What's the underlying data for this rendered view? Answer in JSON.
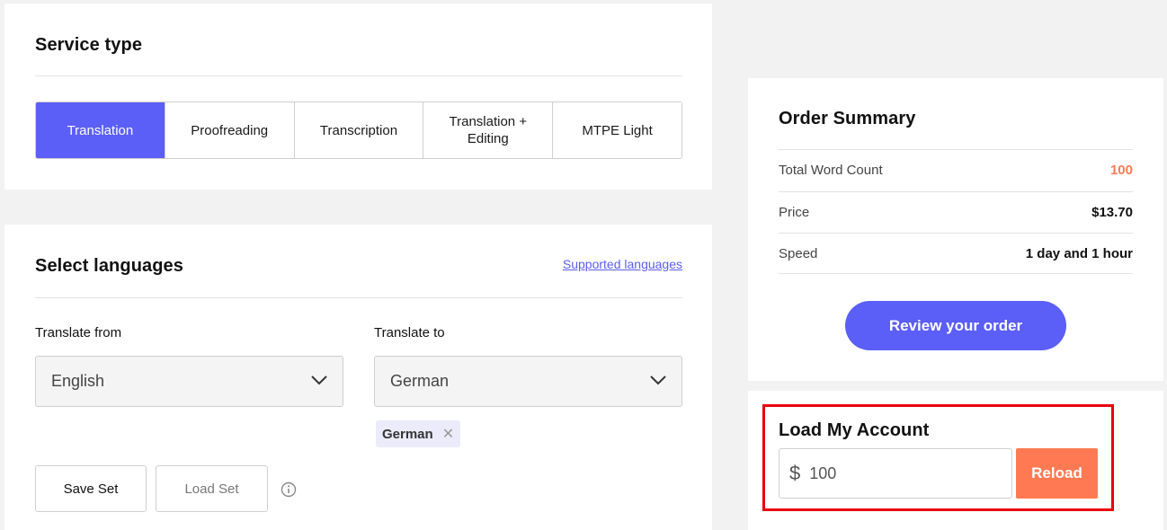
{
  "service": {
    "title": "Service type",
    "tabs": [
      {
        "label": "Translation",
        "active": true
      },
      {
        "label": "Proofreading",
        "active": false
      },
      {
        "label": "Transcription",
        "active": false
      },
      {
        "label": "Translation + Editing",
        "active": false
      },
      {
        "label": "MTPE Light",
        "active": false
      }
    ]
  },
  "languages": {
    "title": "Select languages",
    "supported_link": "Supported languages",
    "from_label": "Translate from",
    "from_value": "English",
    "to_label": "Translate to",
    "to_value": "German",
    "chip": "German",
    "save_set": "Save Set",
    "load_set": "Load Set"
  },
  "summary": {
    "title": "Order Summary",
    "word_count_label": "Total Word Count",
    "word_count_value": "100",
    "price_label": "Price",
    "price_value": "$13.70",
    "speed_label": "Speed",
    "speed_value": "1 day and 1 hour",
    "review_button": "Review your order"
  },
  "load_account": {
    "title": "Load My Account",
    "currency": "$",
    "amount": "100",
    "reload_button": "Reload"
  },
  "colors": {
    "accent": "#5b5ef7",
    "orange": "#ff7a52",
    "highlight": "#e8000b"
  },
  "icons": [
    "chevron-down-icon",
    "close-icon",
    "info-icon"
  ]
}
